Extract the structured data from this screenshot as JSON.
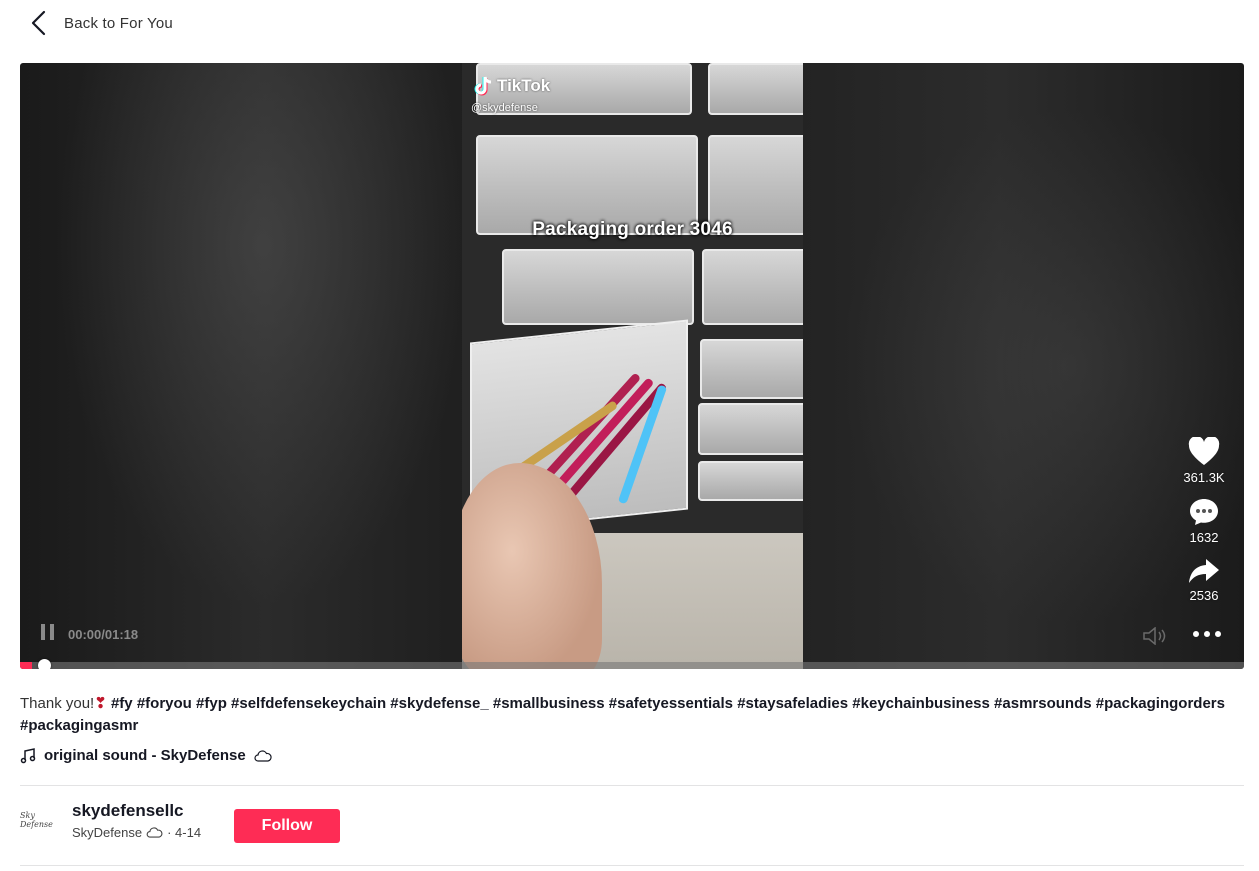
{
  "nav": {
    "back_label": "Back to For You"
  },
  "video": {
    "brand": "TikTok",
    "handle": "@skydefense",
    "overlay_text": "Packaging order 3046",
    "current_time": "00:00",
    "duration": "01:18",
    "time_display": "00:00/01:18",
    "progress_fraction": 0.01,
    "playing": true
  },
  "actions": {
    "likes": "361.3K",
    "comments": "1632",
    "shares": "2536"
  },
  "description": {
    "text": "Thank you!",
    "emoji": "❣",
    "hashtags": [
      "#fy",
      "#foryou",
      "#fyp",
      "#selfdefensekeychain",
      "#skydefense_",
      "#smallbusiness",
      "#safetyessentials",
      "#staysafeladies",
      "#keychainbusiness",
      "#asmrsounds",
      "#packagingorders",
      "#packagingasmr"
    ]
  },
  "sound": {
    "label": "original sound - SkyDefense"
  },
  "author": {
    "avatar_text": "Sky Defense",
    "username": "skydefensellc",
    "nickname": "SkyDefense",
    "date": "· 4-14",
    "follow_label": "Follow"
  },
  "colors": {
    "accent": "#fe2c55",
    "text": "#161823",
    "divider": "#e3e3e4"
  }
}
